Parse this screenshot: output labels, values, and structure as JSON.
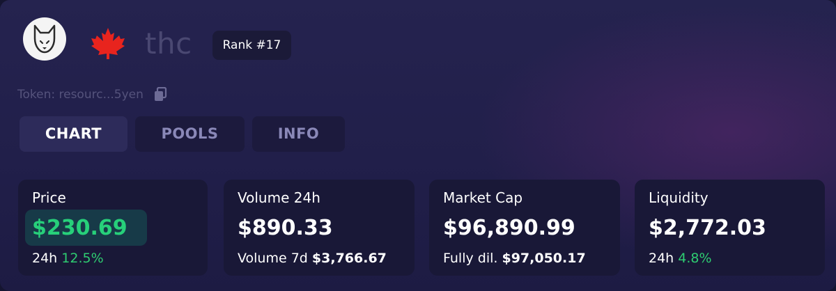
{
  "header": {
    "ticker": "thc",
    "rank": "Rank #17",
    "token_label": "Token: resourc...5yen"
  },
  "tabs": [
    {
      "label": "CHART",
      "active": true
    },
    {
      "label": "POOLS",
      "active": false
    },
    {
      "label": "INFO",
      "active": false
    }
  ],
  "stats": {
    "price": {
      "label": "Price",
      "value": "$230.69",
      "sub_prefix": "24h",
      "sub_value": "12.5%"
    },
    "volume": {
      "label": "Volume 24h",
      "value": "$890.33",
      "sub_prefix": "Volume 7d",
      "sub_value": "$3,766.67"
    },
    "market_cap": {
      "label": "Market Cap",
      "value": "$96,890.99",
      "sub_prefix": "Fully dil.",
      "sub_value": "$97,050.17"
    },
    "liquidity": {
      "label": "Liquidity",
      "value": "$2,772.03",
      "sub_prefix": "24h",
      "sub_value": "4.8%"
    }
  },
  "icons": {
    "avatar": "dog-logo-icon",
    "flag": "maple-leaf-icon",
    "copy": "copy-icon"
  },
  "colors": {
    "positive": "#2ecc71",
    "price_pill": "#173a48",
    "card_bg": "#191837",
    "tab_active": "#2d2b5a"
  }
}
